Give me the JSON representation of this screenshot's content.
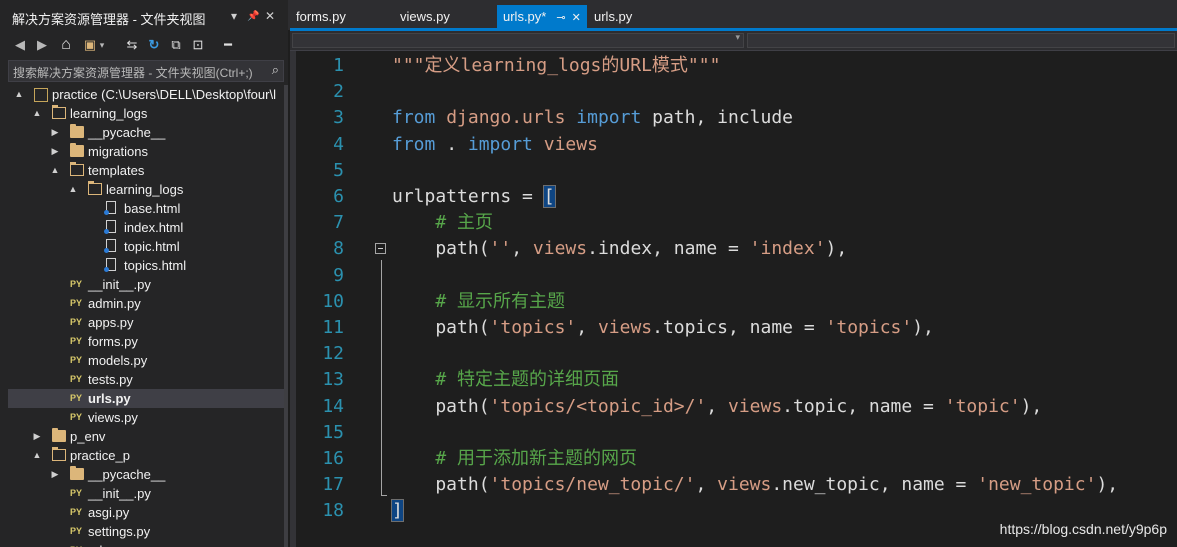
{
  "explorer": {
    "title": "解决方案资源管理器 - 文件夹视图",
    "dropdown": "▾",
    "pin": "📌",
    "close": "✕",
    "search_placeholder": "搜索解决方案资源管理器 - 文件夹视图(Ctrl+;)",
    "toolbar": {
      "back": "◀",
      "forward": "▶",
      "home": "⌂",
      "switch_views": "▣",
      "switch_views_dd": "▾",
      "sync": "⇆",
      "refresh": "↻",
      "collapse": "⧉",
      "show_all": "⊡",
      "properties": "━"
    },
    "tree": [
      {
        "label": "practice (C:\\Users\\DELL\\Desktop\\four\\l",
        "depth": 0,
        "icon": "solution",
        "arrow": "▲"
      },
      {
        "label": "learning_logs",
        "depth": 1,
        "icon": "folder-open",
        "arrow": "▲"
      },
      {
        "label": "__pycache__",
        "depth": 2,
        "icon": "folder",
        "arrow": "▶"
      },
      {
        "label": "migrations",
        "depth": 2,
        "icon": "folder",
        "arrow": "▶"
      },
      {
        "label": "templates",
        "depth": 2,
        "icon": "folder-open",
        "arrow": "▲"
      },
      {
        "label": "learning_logs",
        "depth": 3,
        "icon": "folder-open",
        "arrow": "▲"
      },
      {
        "label": "base.html",
        "depth": 4,
        "icon": "html",
        "arrow": ""
      },
      {
        "label": "index.html",
        "depth": 4,
        "icon": "html",
        "arrow": ""
      },
      {
        "label": "topic.html",
        "depth": 4,
        "icon": "html",
        "arrow": ""
      },
      {
        "label": "topics.html",
        "depth": 4,
        "icon": "html",
        "arrow": ""
      },
      {
        "label": "__init__.py",
        "depth": 2,
        "icon": "py",
        "arrow": ""
      },
      {
        "label": "admin.py",
        "depth": 2,
        "icon": "py",
        "arrow": ""
      },
      {
        "label": "apps.py",
        "depth": 2,
        "icon": "py",
        "arrow": ""
      },
      {
        "label": "forms.py",
        "depth": 2,
        "icon": "py",
        "arrow": ""
      },
      {
        "label": "models.py",
        "depth": 2,
        "icon": "py",
        "arrow": ""
      },
      {
        "label": "tests.py",
        "depth": 2,
        "icon": "py",
        "arrow": ""
      },
      {
        "label": "urls.py",
        "depth": 2,
        "icon": "py",
        "arrow": "",
        "selected": true
      },
      {
        "label": "views.py",
        "depth": 2,
        "icon": "py",
        "arrow": ""
      },
      {
        "label": "p_env",
        "depth": 1,
        "icon": "folder",
        "arrow": "▶"
      },
      {
        "label": "practice_p",
        "depth": 1,
        "icon": "folder-open",
        "arrow": "▲"
      },
      {
        "label": "__pycache__",
        "depth": 2,
        "icon": "folder",
        "arrow": "▶"
      },
      {
        "label": "__init__.py",
        "depth": 2,
        "icon": "py",
        "arrow": ""
      },
      {
        "label": "asgi.py",
        "depth": 2,
        "icon": "py",
        "arrow": ""
      },
      {
        "label": "settings.py",
        "depth": 2,
        "icon": "py",
        "arrow": ""
      },
      {
        "label": "urls.py",
        "depth": 2,
        "icon": "py",
        "arrow": ""
      }
    ],
    "py_badge": "PY"
  },
  "tabs": [
    {
      "label": "forms.py",
      "active": false
    },
    {
      "label": "views.py",
      "active": false
    },
    {
      "label": "urls.py*",
      "active": true,
      "pin": "⊸",
      "close": "✕"
    },
    {
      "label": "urls.py",
      "active": false
    }
  ],
  "navbar": {
    "dropdown": "▾"
  },
  "editor": {
    "line_numbers": [
      "1",
      "2",
      "3",
      "4",
      "5",
      "6",
      "7",
      "8",
      "9",
      "10",
      "11",
      "12",
      "13",
      "14",
      "15",
      "16",
      "17",
      "18"
    ],
    "lines": [
      [
        {
          "t": "\"\"\"定义learning_logs的URL模式\"\"\"",
          "c": "str"
        }
      ],
      [],
      [
        {
          "t": "from",
          "c": "kw"
        },
        {
          "t": " "
        },
        {
          "t": "django.urls",
          "c": "str"
        },
        {
          "t": " "
        },
        {
          "t": "import",
          "c": "kw"
        },
        {
          "t": " path, include"
        }
      ],
      [
        {
          "t": "from",
          "c": "kw"
        },
        {
          "t": " . "
        },
        {
          "t": "import",
          "c": "kw"
        },
        {
          "t": " "
        },
        {
          "t": "views",
          "c": "str"
        }
      ],
      [],
      [
        {
          "t": "urlpatterns = "
        },
        {
          "t": "[",
          "c": "hl"
        }
      ],
      [
        {
          "t": "    "
        },
        {
          "t": "# 主页",
          "c": "cm"
        }
      ],
      [
        {
          "t": "    path("
        },
        {
          "t": "''",
          "c": "str"
        },
        {
          "t": ", "
        },
        {
          "t": "views",
          "c": "str"
        },
        {
          "t": ".index, name = "
        },
        {
          "t": "'index'",
          "c": "str"
        },
        {
          "t": "),"
        }
      ],
      [],
      [
        {
          "t": "    "
        },
        {
          "t": "# 显示所有主题",
          "c": "cm"
        }
      ],
      [
        {
          "t": "    path("
        },
        {
          "t": "'topics'",
          "c": "str"
        },
        {
          "t": ", "
        },
        {
          "t": "views",
          "c": "str"
        },
        {
          "t": ".topics, name = "
        },
        {
          "t": "'topics'",
          "c": "str"
        },
        {
          "t": "),"
        }
      ],
      [],
      [
        {
          "t": "    "
        },
        {
          "t": "# 特定主题的详细页面",
          "c": "cm"
        }
      ],
      [
        {
          "t": "    path("
        },
        {
          "t": "'topics/<topic_id>/'",
          "c": "str"
        },
        {
          "t": ", "
        },
        {
          "t": "views",
          "c": "str"
        },
        {
          "t": ".topic, name = "
        },
        {
          "t": "'topic'",
          "c": "str"
        },
        {
          "t": "),"
        }
      ],
      [],
      [
        {
          "t": "    "
        },
        {
          "t": "# 用于添加新主题的网页",
          "c": "cm"
        }
      ],
      [
        {
          "t": "    path("
        },
        {
          "t": "'topics/new_topic/'",
          "c": "str"
        },
        {
          "t": ", "
        },
        {
          "t": "views",
          "c": "str"
        },
        {
          "t": ".new_topic, name = "
        },
        {
          "t": "'new_topic'",
          "c": "str"
        },
        {
          "t": "),"
        }
      ],
      [
        {
          "t": "]",
          "c": "hl"
        }
      ]
    ]
  },
  "watermark": "https://blog.csdn.net/y9p6p",
  "colors": {
    "accent": "#007acc",
    "keyword": "#569cd6",
    "string": "#d69d85",
    "comment": "#57a64a",
    "line_number": "#2b91af"
  }
}
